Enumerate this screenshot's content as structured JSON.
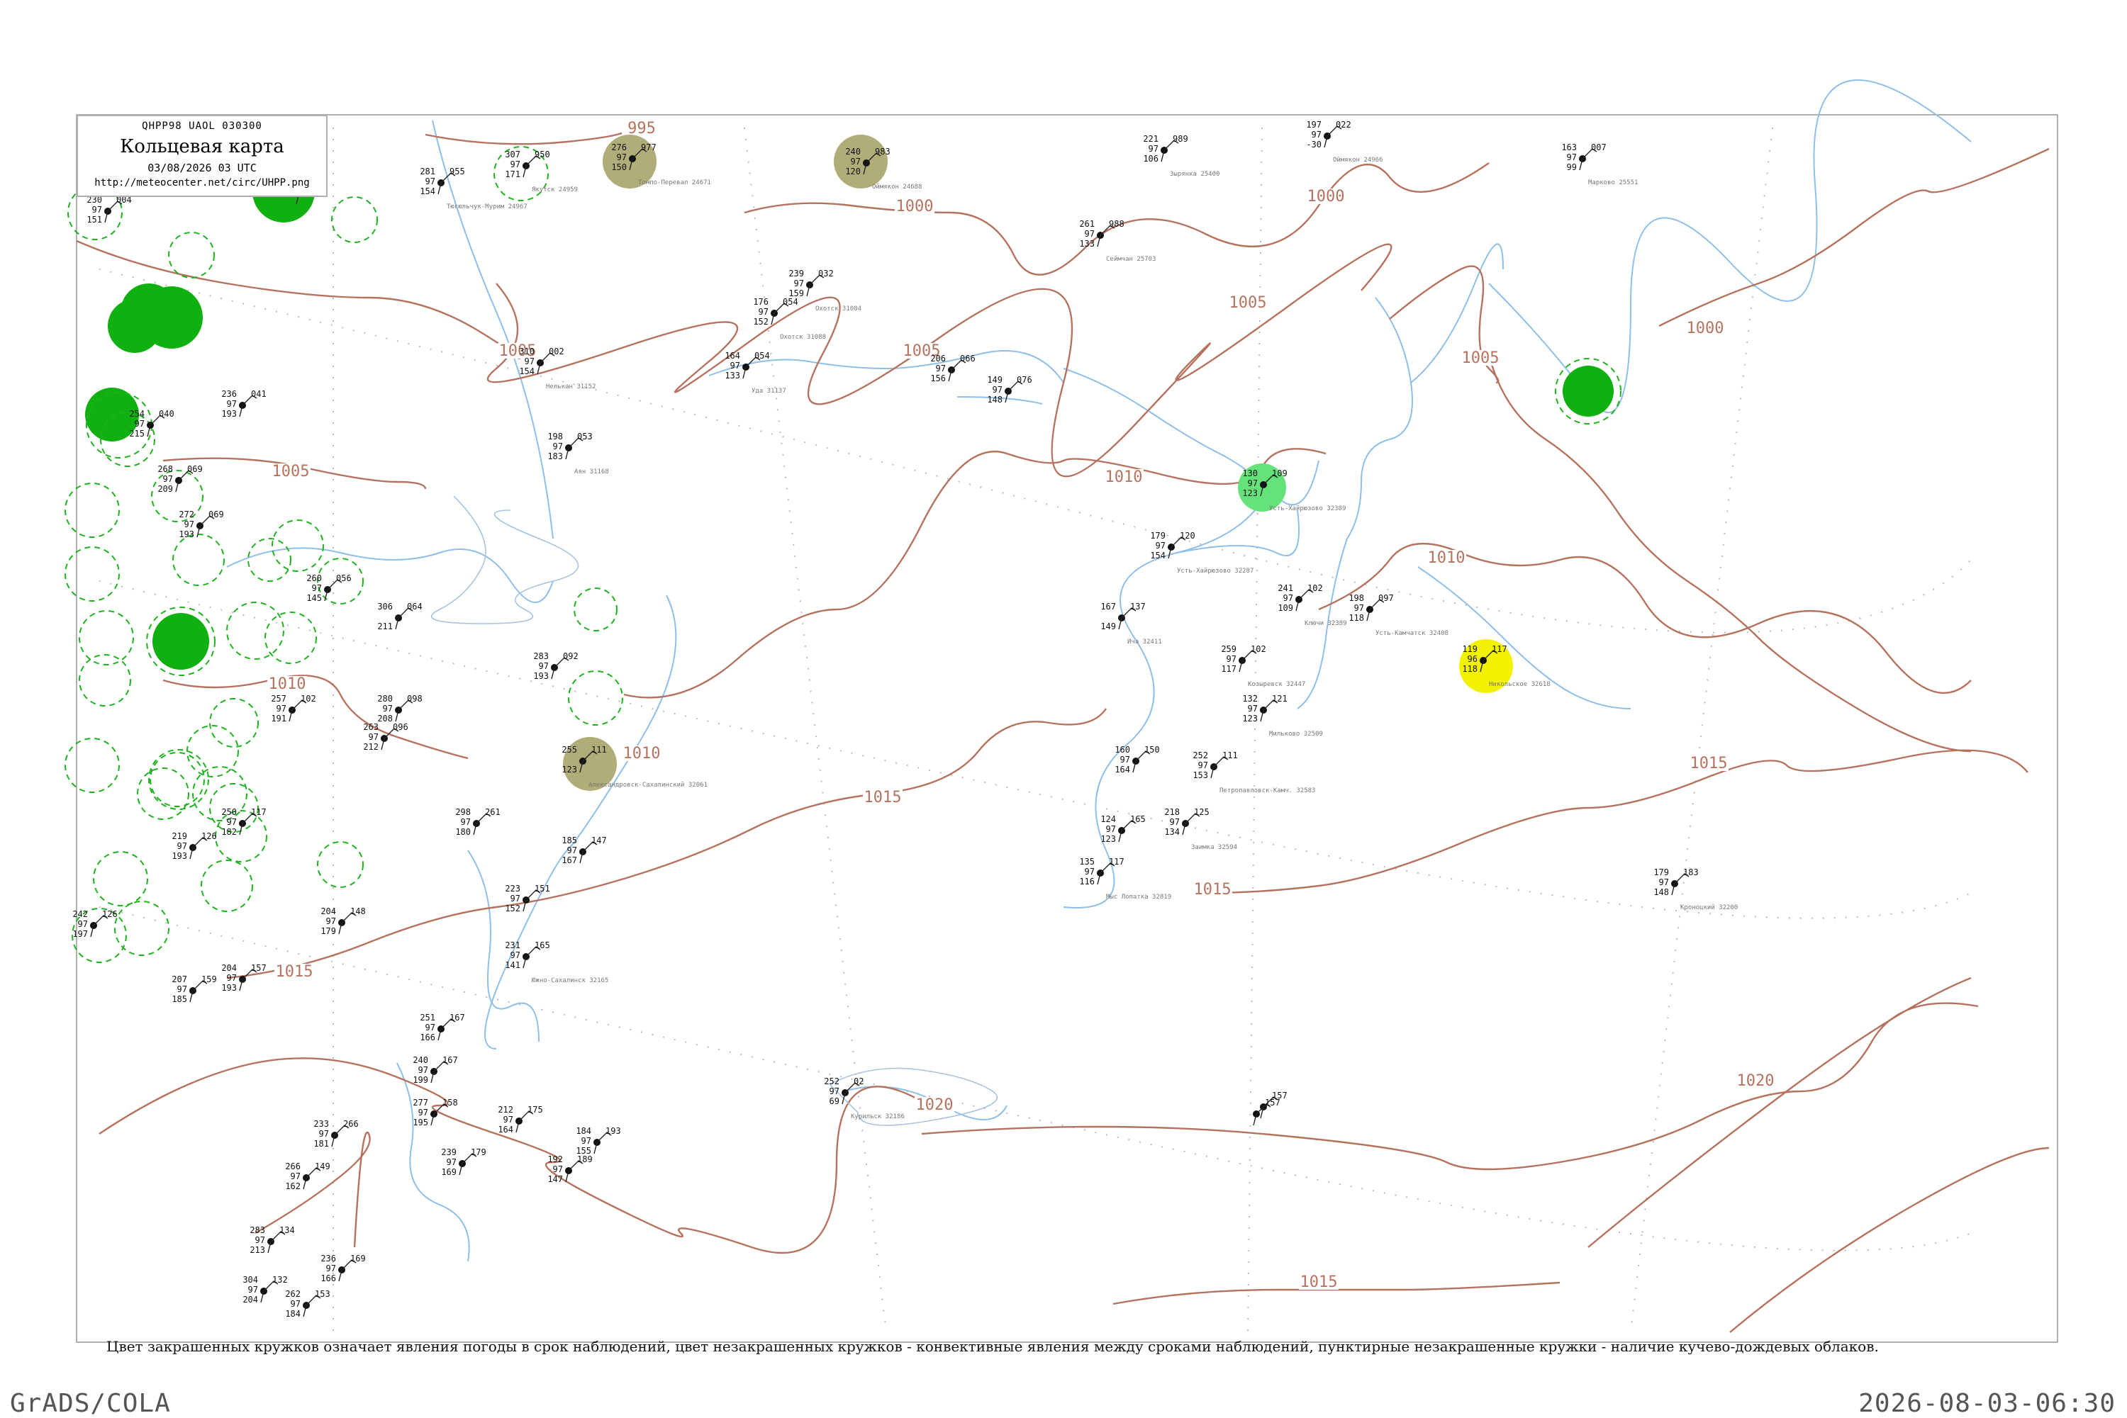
{
  "header": {
    "code": "QHPP98  UAOL  030300",
    "title": "Кольцевая карта",
    "datetime": "03/08/2026 03 UTC",
    "url": "http://meteocenter.net/circ/UHPP.png"
  },
  "caption": "Цвет закрашенных кружков означает явления погоды в срок наблюдений, цвет незакрашенных кружков - конвективные явления между сроками наблюдений, пунктирные незакрашенные кружки - наличие кучево-дождевых облаков.",
  "footer": {
    "left": "GrADS/COLA",
    "right": "2026-08-03-06:30"
  },
  "colors": {
    "isobar": "#b5735f",
    "river": "#8fbfe8",
    "frame": "#b0b0b0",
    "rain": "#10b010",
    "light_rain": "#66e27a",
    "fog": "#b0ad78",
    "haze": "#f2f200",
    "cb": "#1fb21f"
  },
  "isobar_labels": [
    {
      "id": "i995",
      "text": "995"
    },
    {
      "id": "i1000a",
      "text": "1000"
    },
    {
      "id": "i1000b",
      "text": "1000"
    },
    {
      "id": "i1000c",
      "text": "1000"
    },
    {
      "id": "i1005a",
      "text": "1005"
    },
    {
      "id": "i1005b",
      "text": "1005"
    },
    {
      "id": "i1005c",
      "text": "1005"
    },
    {
      "id": "i1005d",
      "text": "1005"
    },
    {
      "id": "i1005e",
      "text": "1005"
    },
    {
      "id": "i1010a",
      "text": "1010"
    },
    {
      "id": "i1010b",
      "text": "1010"
    },
    {
      "id": "i1010c",
      "text": "1010"
    },
    {
      "id": "i1010d",
      "text": "1010"
    },
    {
      "id": "i1015a",
      "text": "1015"
    },
    {
      "id": "i1015b",
      "text": "1015"
    },
    {
      "id": "i1015c",
      "text": "1015"
    },
    {
      "id": "i1015d",
      "text": "1015"
    },
    {
      "id": "i1015e",
      "text": "1015"
    },
    {
      "id": "i1020a",
      "text": "1020"
    },
    {
      "id": "i1020b",
      "text": "1020"
    }
  ],
  "stations": [
    {
      "id": "s_rainwest1",
      "lines": [
        "",
        "",
        ""
      ]
    },
    {
      "id": "s_25400",
      "lines": [
        "221",
        "97",
        "106"
      ],
      "ext": "989",
      "name": "Зырянка 25400"
    },
    {
      "id": "s_24966",
      "lines": [
        "197",
        "97",
        "-30"
      ],
      "ext": "022",
      "name": "Оймякон 24966"
    },
    {
      "id": "s_25551",
      "lines": [
        "163",
        "97",
        "99"
      ],
      "ext": "007",
      "name": "Марково 25551"
    },
    {
      "id": "s_24959",
      "lines": [
        "307",
        "97",
        "171"
      ],
      "ext": "950",
      "name": "Якутск 24959"
    },
    {
      "id": "s_24944",
      "lines": [
        "230",
        "97",
        "151"
      ],
      "ext": "004"
    },
    {
      "id": "s_24967",
      "lines": [
        "281",
        "97",
        "154"
      ],
      "ext": "955",
      "name": "Тюгюльчук-Мурим 24967"
    },
    {
      "id": "s_24688",
      "lines": [
        "240",
        "97",
        "120"
      ],
      "ext": "983",
      "name": "Оймякон 24688"
    },
    {
      "id": "s_24671",
      "lines": [
        "276",
        "97",
        "150"
      ],
      "ext": "977",
      "name": "Томпо-Перевал 24671"
    },
    {
      "id": "s_25703",
      "lines": [
        "261",
        "97",
        "133"
      ],
      "ext": "988",
      "name": "Сеймчан 25703"
    },
    {
      "id": "s_31004",
      "lines": [
        "239",
        "97",
        "159"
      ],
      "ext": "032",
      "name": "Охотск 31004"
    },
    {
      "id": "s_31088",
      "lines": [
        "176",
        "97",
        "152"
      ],
      "ext": "054",
      "name": "Охотск 31088"
    },
    {
      "id": "s_31152",
      "lines": [
        "310",
        "97",
        "154"
      ],
      "ext": "002",
      "name": "Нелькан 31152"
    },
    {
      "id": "s_31168",
      "lines": [
        "198",
        "97",
        "183"
      ],
      "ext": "053",
      "name": "Аян 31168"
    },
    {
      "id": "s_31137",
      "lines": [
        "164",
        "97",
        "133"
      ],
      "ext": "054",
      "name": "Уда 31137"
    },
    {
      "id": "s_31092",
      "lines": [
        "206",
        "97",
        "156"
      ],
      "ext": "066"
    },
    {
      "id": "s_31062",
      "lines": [
        "149",
        "97",
        "148"
      ],
      "ext": "076"
    },
    {
      "id": "s_32389",
      "lines": [
        "130",
        "97",
        "123"
      ],
      "ext": "109",
      "name": "Усть-Хайрюзово 32389"
    },
    {
      "id": "s_32287",
      "lines": [
        "179",
        "97",
        "154"
      ],
      "ext": "120",
      "name": "Усть-Хайрюзово 32287"
    },
    {
      "id": "s_32389b",
      "lines": [
        "241",
        "97",
        "109"
      ],
      "ext": "102",
      "name": "Ключи 32389"
    },
    {
      "id": "s_32408",
      "lines": [
        "198",
        "97",
        "118"
      ],
      "ext": "097",
      "name": "Усть-Камчатск 32408"
    },
    {
      "id": "s_32618",
      "lines": [
        "119",
        "96",
        "118"
      ],
      "ext": "117",
      "name": "Никольское 32618"
    },
    {
      "id": "s_32411",
      "lines": [
        "167",
        "",
        "149"
      ],
      "ext": "137",
      "name": "Ича 32411"
    },
    {
      "id": "s_32447",
      "lines": [
        "259",
        "97",
        "117"
      ],
      "ext": "102",
      "name": "Козыревск 32447"
    },
    {
      "id": "s_32509",
      "lines": [
        "132",
        "97",
        "123"
      ],
      "ext": "121",
      "name": "Мильково 32509"
    },
    {
      "id": "s_32540",
      "lines": [
        "160",
        "97",
        "164"
      ],
      "ext": "150"
    },
    {
      "id": "s_32583",
      "lines": [
        "252",
        "97",
        "153"
      ],
      "ext": "111",
      "name": "Петропавловск-Камч. 32583"
    },
    {
      "id": "s_32594",
      "lines": [
        "218",
        "97",
        "134"
      ],
      "ext": "125",
      "name": "Заимка 32594"
    },
    {
      "id": "s_32618b",
      "lines": [
        "124",
        "97",
        "123"
      ],
      "ext": "165"
    },
    {
      "id": "s_32819",
      "lines": [
        "135",
        "97",
        "116"
      ],
      "ext": "117",
      "name": "Мыс Лопатка 32819"
    },
    {
      "id": "s_32200",
      "lines": [
        "179",
        "97",
        "148"
      ],
      "ext": "183",
      "name": "Кроноцкий 32200"
    },
    {
      "id": "s_32061",
      "lines": [
        "255",
        "",
        "123"
      ],
      "ext": "111",
      "name": "Александровск-Сахалинский 32061"
    },
    {
      "id": "s_31845",
      "lines": [
        "185",
        "97",
        "167"
      ],
      "ext": "147"
    },
    {
      "id": "s_32150",
      "lines": [
        "223",
        "97",
        "152"
      ],
      "ext": "151"
    },
    {
      "id": "s_32165",
      "lines": [
        "231",
        "97",
        "141"
      ],
      "ext": "165",
      "name": "Южно-Сахалинск 32165"
    },
    {
      "id": "s_32186",
      "lines": [
        "252",
        "97",
        "69"
      ],
      "ext": "02",
      "name": "Курильск 32186"
    },
    {
      "id": "s_47401",
      "lines": [
        "",
        "",
        ""
      ],
      "ext": "157"
    },
    {
      "id": "s_31873",
      "lines": [
        "263",
        "97",
        "212"
      ],
      "ext": "096"
    },
    {
      "id": "s_31770",
      "lines": [
        "298",
        "97",
        "180"
      ],
      "ext": "261"
    },
    {
      "id": "s_31532",
      "lines": [
        "280",
        "97",
        "208"
      ],
      "ext": "098"
    },
    {
      "id": "s_31439",
      "lines": [
        "283",
        "97",
        "193"
      ],
      "ext": "092"
    },
    {
      "id": "s_31416",
      "lines": [
        "306",
        "",
        "211"
      ],
      "ext": "064"
    },
    {
      "id": "s_31369",
      "lines": [
        "260",
        "97",
        "145"
      ],
      "ext": "056"
    },
    {
      "id": "s_31329",
      "lines": [
        "272",
        "97",
        "193"
      ],
      "ext": "069"
    },
    {
      "id": "s_31253",
      "lines": [
        "236",
        "97",
        "193"
      ],
      "ext": "041"
    },
    {
      "id": "s_31300",
      "lines": [
        "254",
        "97",
        "215"
      ],
      "ext": "040"
    },
    {
      "id": "s_31510",
      "lines": [
        "268",
        "97",
        "209"
      ],
      "ext": "069"
    },
    {
      "id": "s_31594",
      "lines": [
        "257",
        "97",
        "191"
      ],
      "ext": "102"
    },
    {
      "id": "s_31735",
      "lines": [
        "250",
        "97",
        "182"
      ],
      "ext": "117"
    },
    {
      "id": "s_31913",
      "lines": [
        "242",
        "97",
        "197"
      ],
      "ext": "126"
    },
    {
      "id": "s_31959",
      "lines": [
        "219",
        "97",
        "193"
      ],
      "ext": "126"
    },
    {
      "id": "s_32027",
      "lines": [
        "204",
        "97",
        "179"
      ],
      "ext": "148"
    },
    {
      "id": "s_31969",
      "lines": [
        "204",
        "97",
        "193"
      ],
      "ext": "157"
    },
    {
      "id": "s_31989",
      "lines": [
        "207",
        "97",
        "185"
      ],
      "ext": "159"
    },
    {
      "id": "s_47458",
      "lines": [
        "233",
        "97",
        "181"
      ],
      "ext": "266"
    },
    {
      "id": "s_47412",
      "lines": [
        "240",
        "97",
        "199"
      ],
      "ext": "167"
    },
    {
      "id": "s_47409",
      "lines": [
        "277",
        "97",
        "195"
      ],
      "ext": "158"
    },
    {
      "id": "s_47418",
      "lines": [
        "239",
        "97",
        "169"
      ],
      "ext": "179"
    },
    {
      "id": "s_47420",
      "lines": [
        "212",
        "97",
        "164"
      ],
      "ext": "175"
    },
    {
      "id": "s_47421",
      "lines": [
        "184",
        "97",
        "155"
      ],
      "ext": "193"
    },
    {
      "id": "s_47426",
      "lines": [
        "192",
        "97",
        "147"
      ],
      "ext": "189"
    },
    {
      "id": "s_47405",
      "lines": [
        "251",
        "97",
        "166"
      ],
      "ext": "167"
    },
    {
      "id": "s_47594",
      "lines": [
        "304",
        "97",
        "204"
      ],
      "ext": "132"
    },
    {
      "id": "s_47583",
      "lines": [
        "262",
        "97",
        "184"
      ],
      "ext": "153"
    },
    {
      "id": "s_47571",
      "lines": [
        "283",
        "97",
        "213"
      ],
      "ext": "134"
    },
    {
      "id": "s_47574",
      "lines": [
        "266",
        "97",
        "162"
      ],
      "ext": "149"
    },
    {
      "id": "s_47583b",
      "lines": [
        "236",
        "97",
        "166"
      ],
      "ext": "169"
    },
    {
      "id": "s_ov1",
      "lines": [
        "",
        "",
        ""
      ],
      "ext": "157"
    }
  ]
}
